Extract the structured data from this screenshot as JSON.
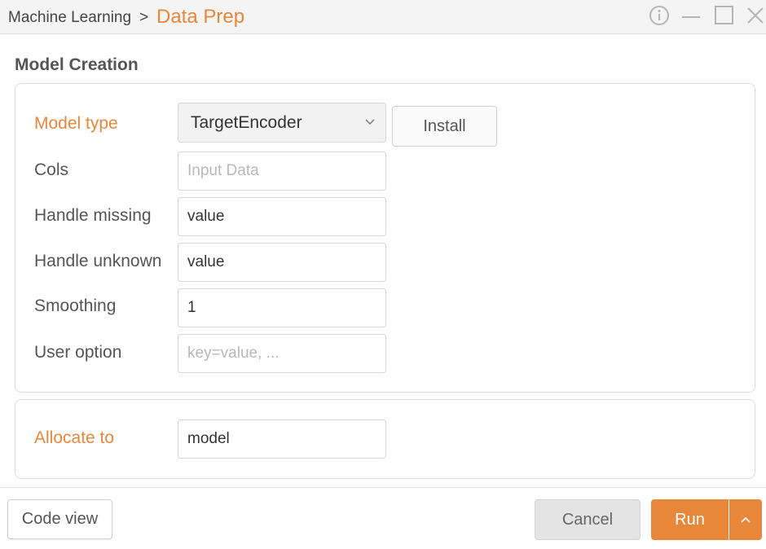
{
  "breadcrumb": {
    "parent": "Machine Learning",
    "separator": ">",
    "current": "Data Prep"
  },
  "window_controls": {
    "icons": [
      "info-icon",
      "minimize-icon",
      "maximize-icon",
      "close-icon"
    ]
  },
  "section": {
    "title": "Model Creation"
  },
  "model": {
    "model_type_label": "Model type",
    "model_type_value": "TargetEncoder",
    "install_label": "Install",
    "cols_label": "Cols",
    "cols_placeholder": "Input Data",
    "handle_missing_label": "Handle missing",
    "handle_missing_value": "value",
    "handle_unknown_label": "Handle unknown",
    "handle_unknown_value": "value",
    "smoothing_label": "Smoothing",
    "smoothing_value": "1",
    "user_option_label": "User option",
    "user_option_placeholder": "key=value, ..."
  },
  "allocate": {
    "label": "Allocate to",
    "value": "model"
  },
  "footer": {
    "code_view_label": "Code view",
    "cancel_label": "Cancel",
    "run_label": "Run"
  },
  "colors": {
    "accent": "#e8873a",
    "titlebar": "#f4f4f4",
    "border": "#dcdcdc"
  }
}
